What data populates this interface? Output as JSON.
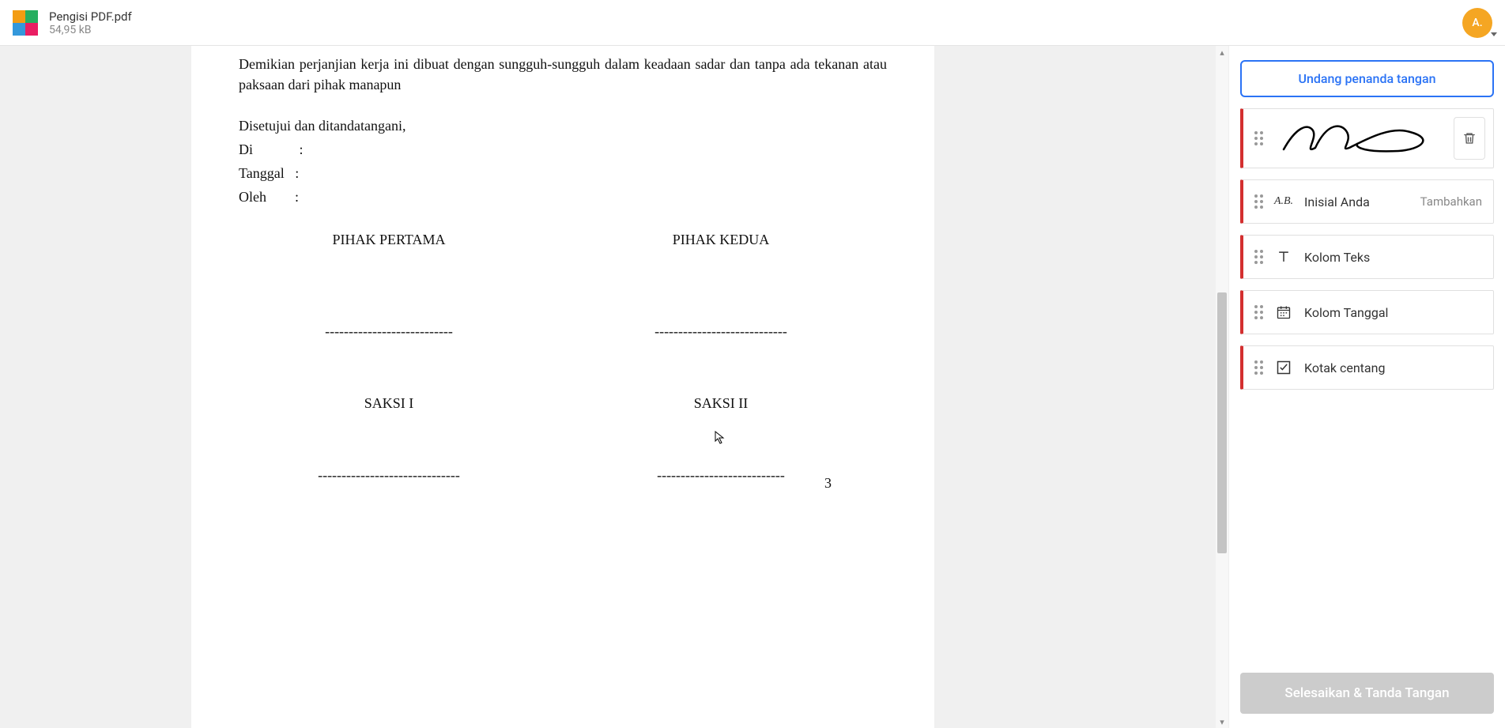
{
  "header": {
    "filename": "Pengisi PDF.pdf",
    "filesize": "54,95 kB",
    "avatar": "A."
  },
  "doc": {
    "para1": "Demikian perjanjian kerja ini dibuat dengan sungguh-sungguh dalam keadaan sadar dan tanpa ada tekanan atau paksaan dari pihak manapun",
    "line_agreed": "Disetujui dan ditandatangani,",
    "line_di": "Di             :",
    "line_tanggal": "Tanggal   :",
    "line_oleh": "Oleh        :",
    "party1": "PIHAK PERTAMA",
    "party2": "PIHAK KEDUA",
    "witness1": "SAKSI  I",
    "witness2": "SAKSI II",
    "dash_short1": "---------------------------",
    "dash_short2": "----------------------------",
    "dash_long1": "------------------------------",
    "dash_long2": "---------------------------",
    "page_number": "3"
  },
  "sidebar": {
    "invite": "Undang penanda tangan",
    "initials_label": "Inisial Anda",
    "initials_action": "Tambahkan",
    "text_label": "Kolom Teks",
    "date_label": "Kolom Tanggal",
    "checkbox_label": "Kotak centang",
    "finish": "Selesaikan & Tanda Tangan"
  }
}
